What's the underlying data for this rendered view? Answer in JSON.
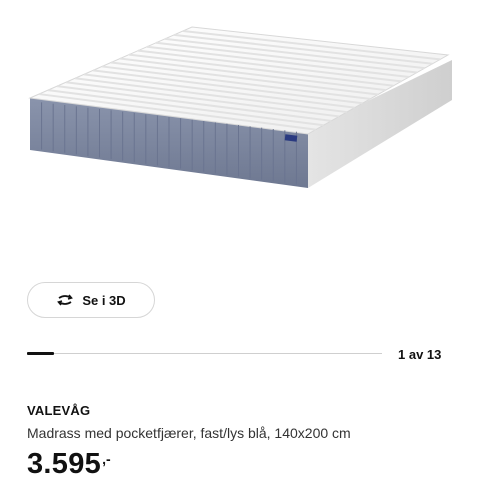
{
  "view3d": {
    "label": "Se i 3D",
    "icon": "rotate-3d-icon"
  },
  "gallery": {
    "counter": "1 av 13",
    "progress": 0.077
  },
  "product": {
    "name": "VALEVÅG",
    "description": "Madrass med pocketfjærer, fast/lys blå, 140x200 cm",
    "price": "3.595",
    "price_suffix": ",-"
  },
  "colors": {
    "mattress_side": "#7f8aa3",
    "mattress_top": "#ffffff",
    "accent": "#111111"
  }
}
